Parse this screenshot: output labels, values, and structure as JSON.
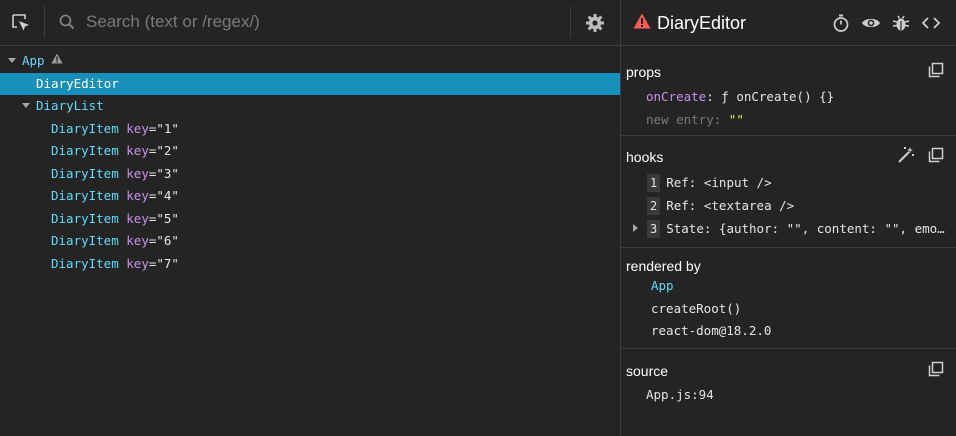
{
  "search": {
    "placeholder": "Search (text or /regex/)"
  },
  "tree": {
    "app_label": "App",
    "editor_label": "DiaryEditor",
    "list_label": "DiaryList",
    "items": [
      {
        "name": "DiaryItem",
        "key_attr": "key",
        "eq": "=",
        "key_value": "\"1\""
      },
      {
        "name": "DiaryItem",
        "key_attr": "key",
        "eq": "=",
        "key_value": "\"2\""
      },
      {
        "name": "DiaryItem",
        "key_attr": "key",
        "eq": "=",
        "key_value": "\"3\""
      },
      {
        "name": "DiaryItem",
        "key_attr": "key",
        "eq": "=",
        "key_value": "\"4\""
      },
      {
        "name": "DiaryItem",
        "key_attr": "key",
        "eq": "=",
        "key_value": "\"5\""
      },
      {
        "name": "DiaryItem",
        "key_attr": "key",
        "eq": "=",
        "key_value": "\"6\""
      },
      {
        "name": "DiaryItem",
        "key_attr": "key",
        "eq": "=",
        "key_value": "\"7\""
      }
    ]
  },
  "inspector": {
    "title": "DiaryEditor",
    "props": {
      "heading": "props",
      "oncreate_name": "onCreate",
      "colon": ":",
      "oncreate_value": "ƒ onCreate() {}",
      "newentry_name": "new entry",
      "newentry_value": "\"\""
    },
    "hooks": {
      "heading": "hooks",
      "items": [
        {
          "index": "1",
          "text": "Ref: <input />"
        },
        {
          "index": "2",
          "text": "Ref: <textarea />"
        },
        {
          "index": "3",
          "text": "State: {author: \"\", content: \"\", emo…"
        }
      ]
    },
    "rendered_by": {
      "heading": "rendered by",
      "owner": "App",
      "root": "createRoot()",
      "version": "react-dom@18.2.0"
    },
    "source": {
      "heading": "source",
      "location": "App.js:94"
    }
  },
  "colors": {
    "background": "#242424",
    "selection": "#178fb9",
    "component": "#61dafb",
    "attribute": "#c792ea",
    "string": "#e8e86a",
    "error": "#ff5a5a",
    "warning": "#a6a6a6"
  },
  "icons": {
    "inspect": "select-element-icon",
    "search": "search-icon",
    "settings": "gear-icon",
    "error": "error-triangle-icon",
    "warning": "warning-triangle-icon",
    "timer": "stopwatch-icon",
    "eye": "eye-icon",
    "bug": "bug-icon",
    "source": "code-brackets-icon",
    "copy": "copy-icon",
    "wand": "magic-wand-icon"
  }
}
